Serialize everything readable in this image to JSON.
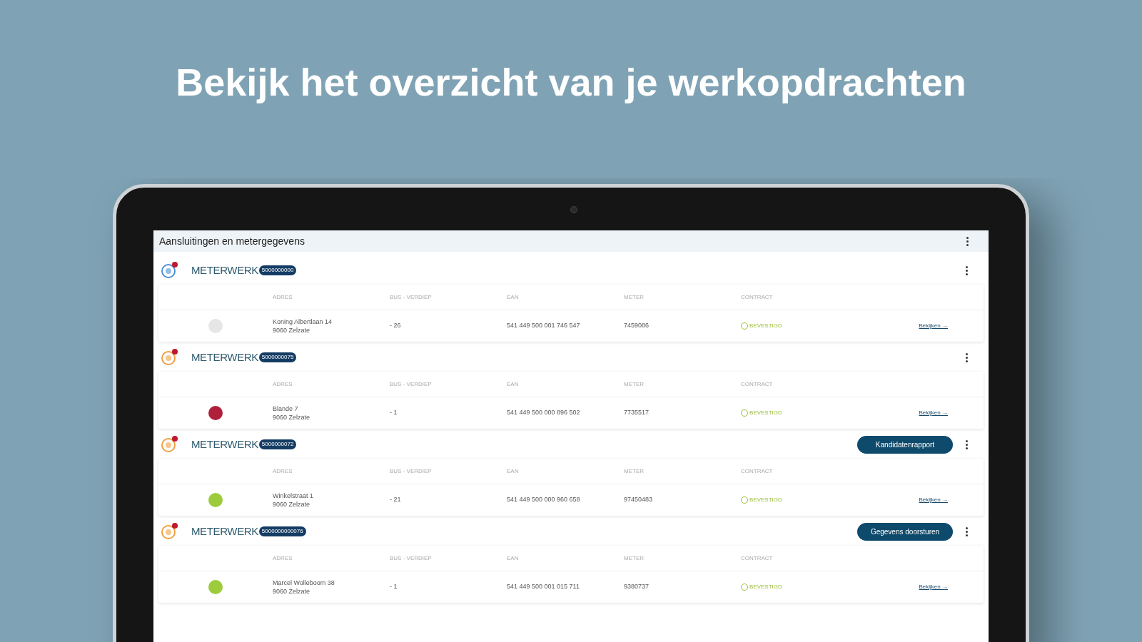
{
  "headline": "Bekijk het overzicht van je werkopdrachten",
  "screen": {
    "title": "Aansluitingen en metergegevens",
    "groups": [
      {
        "label": "METERWERK",
        "number": "5000000000",
        "color": "#4a90d9",
        "columns": [
          "ADRES",
          "BUS - VERDIEP",
          "EAN",
          "METER",
          "CONTRACT"
        ],
        "row": {
          "color": "#e6e6e6",
          "address": "Koning Albertlaan 14",
          "city": "9060 Zelzate",
          "bus": "- 26",
          "ean": "541 449 500 001 746 547",
          "meter": "7459086",
          "contract": "BEVESTIGD",
          "link": "Bekijken →"
        }
      },
      {
        "label": "METERWERK",
        "number": "5000000075",
        "color": "#f0a040",
        "columns": [
          "ADRES",
          "BUS - VERDIEP",
          "EAN",
          "METER",
          "CONTRACT"
        ],
        "row": {
          "color": "#b0203a",
          "address": "Blande 7",
          "city": "9060 Zelzate",
          "bus": "- 1",
          "ean": "541 449 500 000 896 502",
          "meter": "7735517",
          "contract": "BEVESTIGD",
          "link": "Bekijken →"
        }
      },
      {
        "label": "METERWERK",
        "number": "5000000072",
        "color": "#f0a040",
        "action": "Kandidatenrapport",
        "columns": [
          "ADRES",
          "BUS - VERDIEP",
          "EAN",
          "METER",
          "CONTRACT"
        ],
        "row": {
          "color": "#9ccc3c",
          "address": "Winkelstraat 1",
          "city": "9060 Zelzate",
          "bus": "- 21",
          "ean": "541 449 500 000 960 658",
          "meter": "97450483",
          "contract": "BEVESTIGD",
          "link": "Bekijken →"
        }
      },
      {
        "label": "METERWERK",
        "number": "5000000000076",
        "color": "#f0a040",
        "action": "Gegevens doorsturen",
        "columns": [
          "ADRES",
          "BUS - VERDIEP",
          "EAN",
          "METER",
          "CONTRACT"
        ],
        "row": {
          "color": "#9ccc3c",
          "address": "Marcel Wolleboom 38",
          "city": "9060 Zelzate",
          "bus": "- 1",
          "ean": "541 449 500 001 015 711",
          "meter": "9380737",
          "contract": "BEVESTIGD",
          "link": "Bekijken →"
        }
      }
    ]
  }
}
